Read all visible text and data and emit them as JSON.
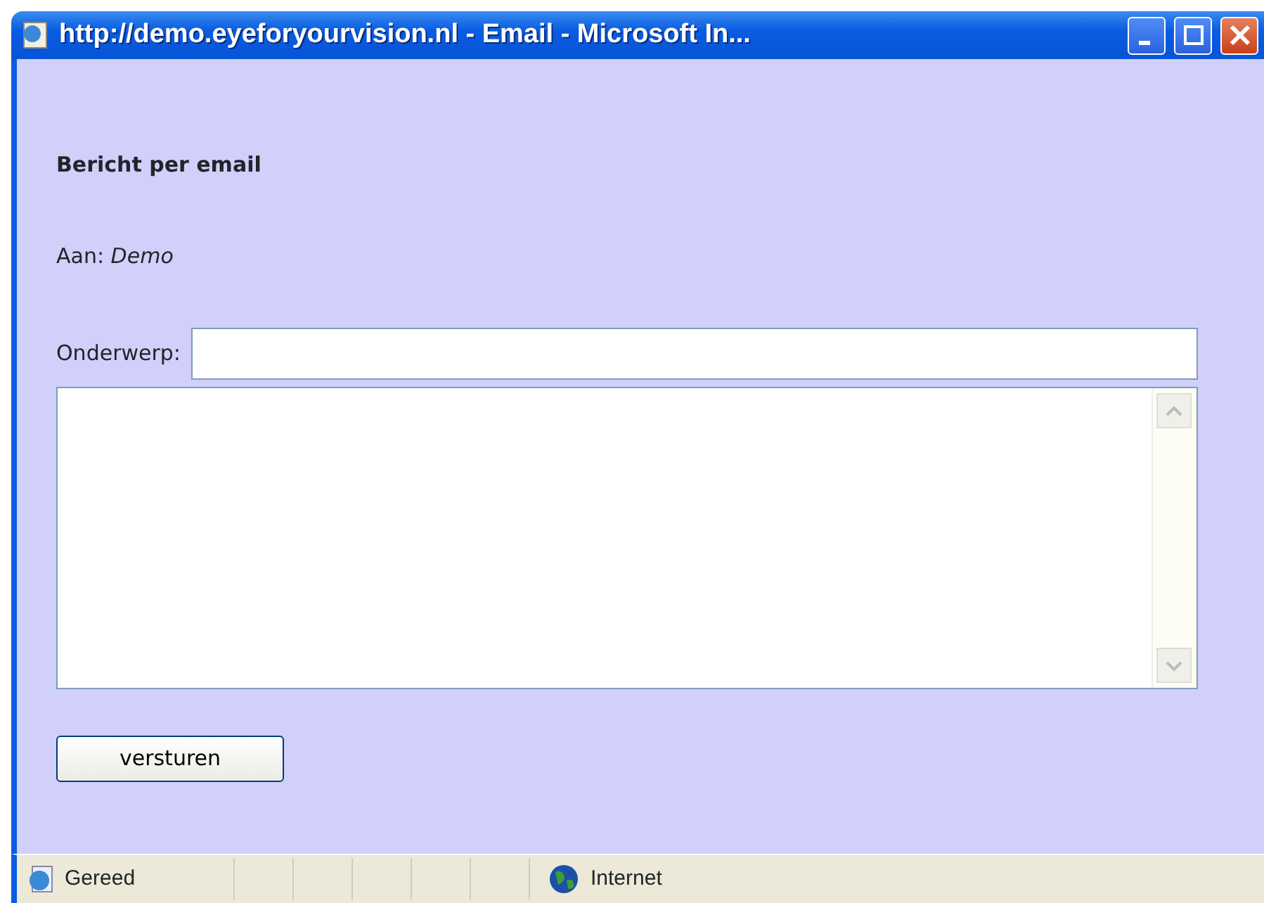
{
  "window": {
    "title": "http://demo.eyeforyourvision.nl - Email - Microsoft In..."
  },
  "form": {
    "heading": "Bericht per email",
    "recipient": "Aan: *Demo*",
    "subject_label": "Onderwerp:",
    "submit": "versturen"
  },
  "status_bar": {
    "status": "Gereed",
    "zone": "Internet"
  }
}
